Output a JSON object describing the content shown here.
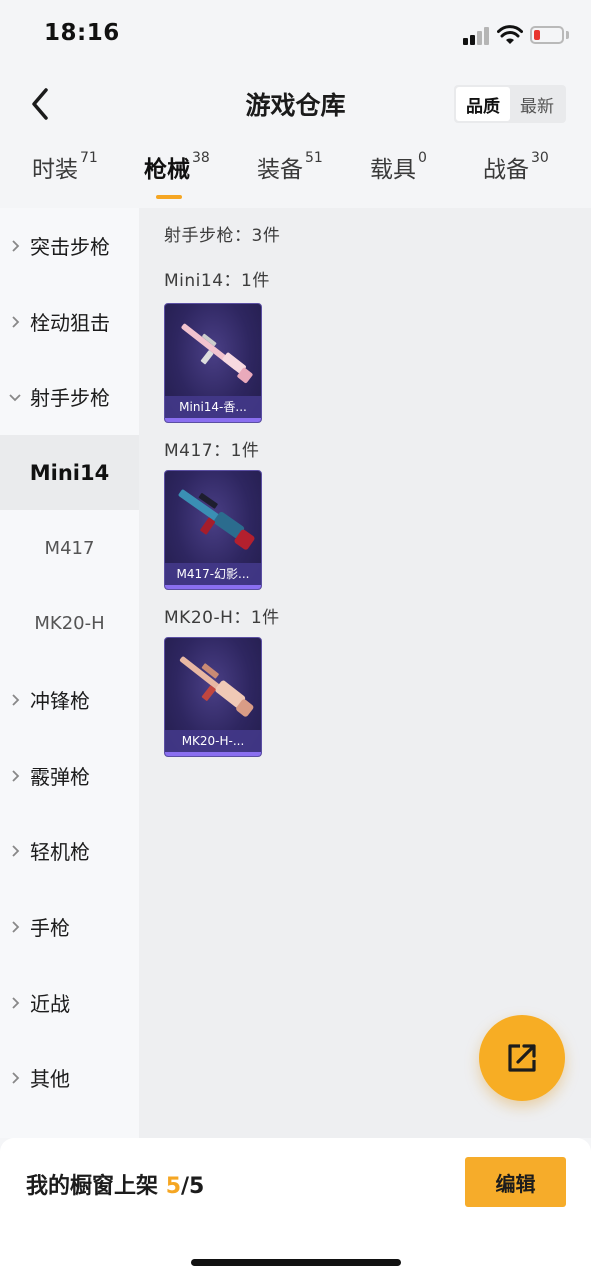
{
  "status_bar": {
    "time": "18:16"
  },
  "header": {
    "title": "游戏仓库",
    "sort_options": [
      {
        "label": "品质",
        "active": true
      },
      {
        "label": "最新",
        "active": false
      }
    ]
  },
  "tabs": [
    {
      "label": "时装",
      "count": "71",
      "active": false
    },
    {
      "label": "枪械",
      "count": "38",
      "active": true
    },
    {
      "label": "装备",
      "count": "51",
      "active": false
    },
    {
      "label": "载具",
      "count": "0",
      "active": false
    },
    {
      "label": "战备",
      "count": "30",
      "active": false
    }
  ],
  "sidebar": {
    "items": [
      {
        "label": "突击步枪",
        "type": "category",
        "expanded": false
      },
      {
        "label": "栓动狙击",
        "type": "category",
        "expanded": false
      },
      {
        "label": "射手步枪",
        "type": "category",
        "expanded": true
      },
      {
        "label": "Mini14",
        "type": "sub",
        "selected": true
      },
      {
        "label": "M417",
        "type": "sub",
        "selected": false
      },
      {
        "label": "MK20-H",
        "type": "sub",
        "selected": false
      },
      {
        "label": "冲锋枪",
        "type": "category",
        "expanded": false
      },
      {
        "label": "霰弹枪",
        "type": "category",
        "expanded": false
      },
      {
        "label": "轻机枪",
        "type": "category",
        "expanded": false
      },
      {
        "label": "手枪",
        "type": "category",
        "expanded": false
      },
      {
        "label": "近战",
        "type": "category",
        "expanded": false
      },
      {
        "label": "其他",
        "type": "category",
        "expanded": false
      }
    ]
  },
  "content": {
    "category_summary": "射手步枪：3件",
    "groups": [
      {
        "title": "Mini14：1件",
        "items": [
          {
            "label": "Mini14-香...",
            "color": "#f2c3cf"
          }
        ]
      },
      {
        "title": "M417：1件",
        "items": [
          {
            "label": "M417-幻影...",
            "color": "#3a8fb4"
          }
        ]
      },
      {
        "title": "MK20-H：1件",
        "items": [
          {
            "label": "MK20-H-...",
            "color": "#e8b8a3"
          }
        ]
      }
    ]
  },
  "bottom_bar": {
    "shelf_label": "我的橱窗上架",
    "shelf_current": "5",
    "shelf_total": "/5",
    "edit_label": "编辑"
  },
  "colors": {
    "accent": "#f5a623",
    "card_bg": "#2e2660"
  }
}
